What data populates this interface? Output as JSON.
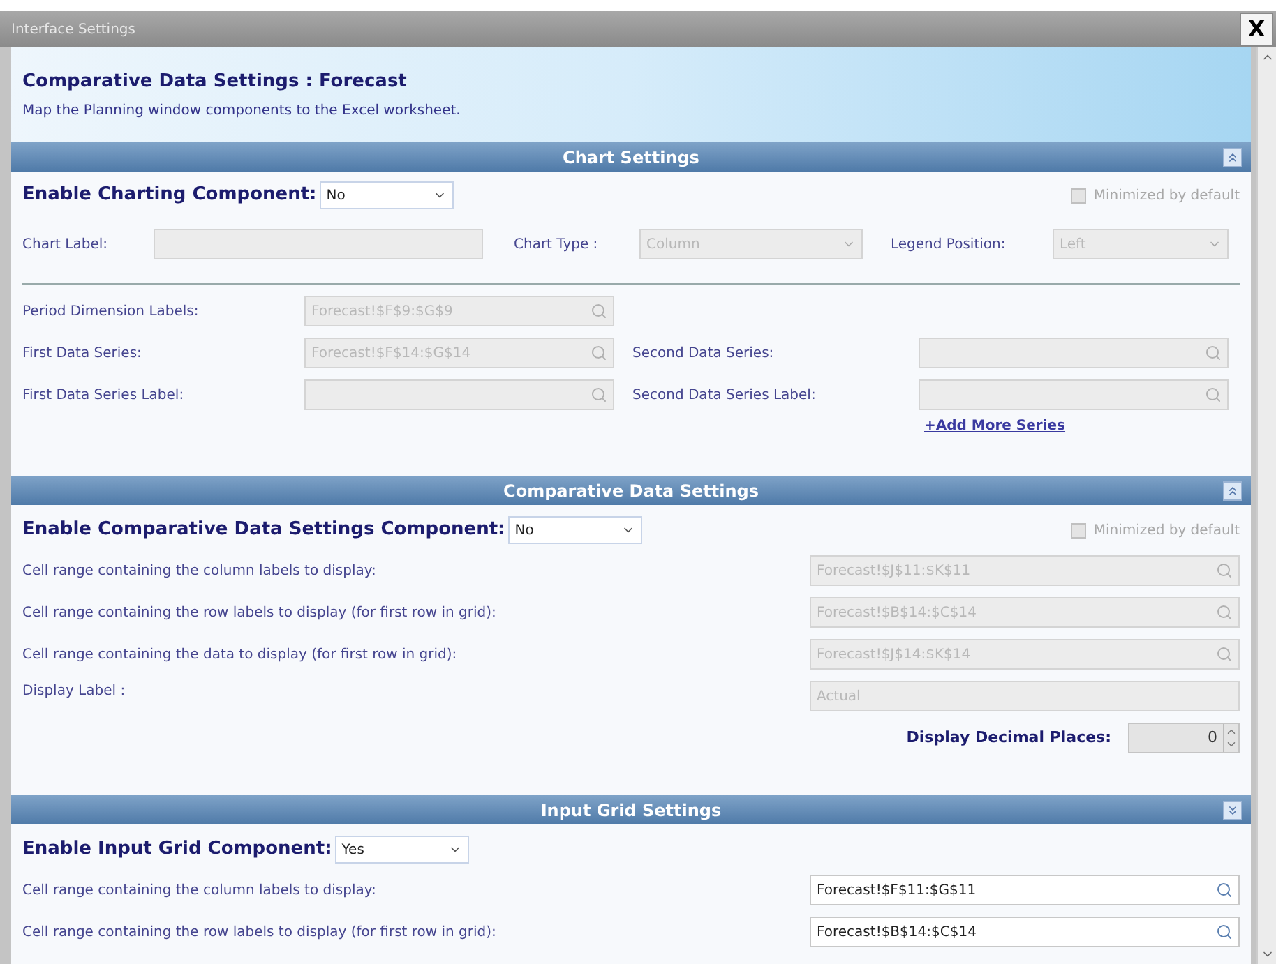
{
  "window": {
    "title": "Interface Settings",
    "close": "X"
  },
  "header": {
    "title": "Comparative Data Settings : Forecast",
    "subtitle": "Map the Planning window components to the Excel worksheet."
  },
  "chart_settings": {
    "title": "Chart Settings",
    "expanded": true,
    "enable": {
      "label": "Enable Charting Component:",
      "value": "No"
    },
    "minimized": {
      "label": "Minimized by default",
      "checked": false,
      "disabled": true
    },
    "chart_label": {
      "label": "Chart Label:",
      "disabled": true
    },
    "chart_type": {
      "label": "Chart Type :",
      "value": "Column",
      "disabled": true
    },
    "legend_position": {
      "label": "Legend Position:",
      "value": "Left",
      "disabled": true
    },
    "period_labels": {
      "label": "Period Dimension Labels:",
      "value": "Forecast!$F$9:$G$9",
      "disabled": true
    },
    "first_series": {
      "label": "First Data Series:",
      "value": "Forecast!$F$14:$G$14",
      "disabled": true
    },
    "second_series": {
      "label": "Second Data Series:",
      "disabled": true
    },
    "first_series_label": {
      "label": "First Data Series Label:",
      "disabled": true
    },
    "second_series_label": {
      "label": "Second Data Series Label:",
      "disabled": true
    },
    "add_series": "+Add More Series"
  },
  "comparative_settings": {
    "title": "Comparative Data Settings",
    "expanded": true,
    "enable": {
      "label": "Enable Comparative Data Settings Component:",
      "value": "No"
    },
    "minimized": {
      "label": "Minimized by default",
      "checked": false,
      "disabled": true
    },
    "rows": [
      {
        "label": "Cell range containing the column labels to display:",
        "value": "Forecast!$J$11:$K$11",
        "disabled": true
      },
      {
        "label": "Cell range containing the row labels to display (for first row in grid):",
        "value": "Forecast!$B$14:$C$14",
        "disabled": true
      },
      {
        "label": "Cell range containing the data to display (for first row in grid):",
        "value": "Forecast!$J$14:$K$14",
        "disabled": true
      }
    ],
    "display_label": {
      "label": "Display Label :",
      "value": "Actual",
      "disabled": true
    },
    "decimal_places": {
      "label": "Display Decimal Places:",
      "value": "0",
      "disabled": true
    }
  },
  "input_grid_settings": {
    "title": "Input Grid Settings",
    "expanded": false,
    "enable": {
      "label": "Enable Input Grid Component:",
      "value": "Yes"
    },
    "rows": [
      {
        "label": "Cell range containing the column labels to display:",
        "value": "Forecast!$F$11:$G$11",
        "disabled": false
      },
      {
        "label": "Cell range containing the row labels to display (for first row in grid):",
        "value": "Forecast!$B$14:$C$14",
        "disabled": false
      }
    ]
  }
}
